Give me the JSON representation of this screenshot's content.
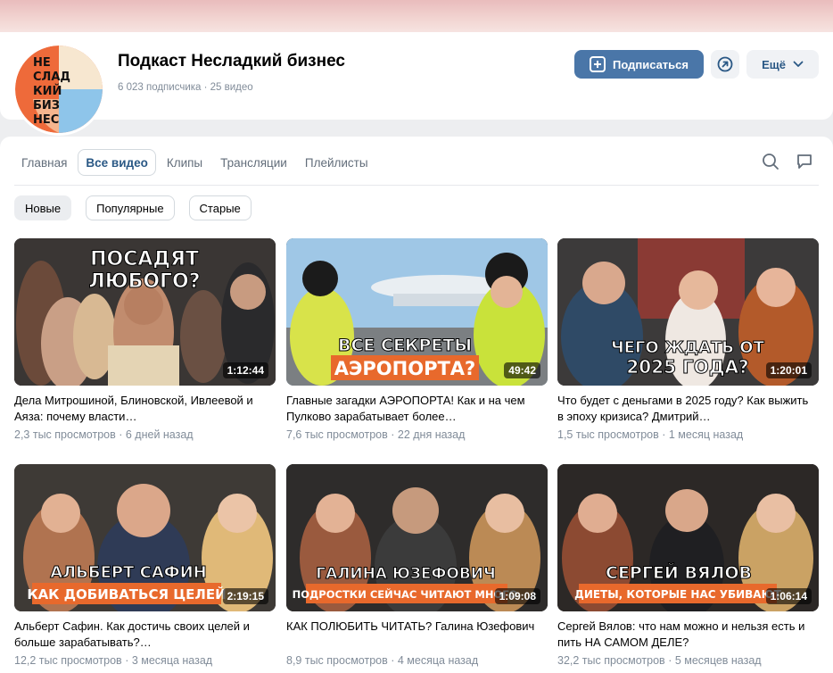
{
  "channel": {
    "title": "Подкаст Несладкий бизнес",
    "subscribers": "6 023 подписчика",
    "videos_count": "25 видео",
    "logo_lines": [
      "НЕ",
      "СЛАД",
      "КИЙ",
      "БИЗ",
      "НЕС"
    ]
  },
  "actions": {
    "subscribe_label": "Подписаться",
    "more_label": "Ещё"
  },
  "tabs": [
    {
      "label": "Главная"
    },
    {
      "label": "Все видео"
    },
    {
      "label": "Клипы"
    },
    {
      "label": "Трансляции"
    },
    {
      "label": "Плейлисты"
    }
  ],
  "filters": [
    {
      "label": "Новые"
    },
    {
      "label": "Популярные"
    },
    {
      "label": "Старые"
    }
  ],
  "videos": [
    {
      "title": "Дела Митрошиной, Блиновской, Ивлеевой и Аяза: почему власти…",
      "views": "2,3 тыс просмотров",
      "age": "6 дней назад",
      "duration": "1:12:44",
      "thumb_lines": [
        "ПОСАДЯТ",
        "ЛЮБОГО?"
      ]
    },
    {
      "title": "Главные загадки АЭРОПОРТА! Как и на чем Пулково зарабатывает более…",
      "views": "7,6 тыс просмотров",
      "age": "22 дня назад",
      "duration": "49:42",
      "thumb_lines": [
        "ВСЕ СЕКРЕТЫ",
        "АЭРОПОРТА?"
      ]
    },
    {
      "title": "Что будет с деньгами в 2025 году? Как выжить в эпоху кризиса? Дмитрий…",
      "views": "1,5 тыс просмотров",
      "age": "1 месяц назад",
      "duration": "1:20:01",
      "thumb_lines": [
        "ЧЕГО ЖДАТЬ ОТ",
        "2025 ГОДА?"
      ]
    },
    {
      "title": "Альберт Сафин. Как достичь своих целей и больше зарабатывать?…",
      "views": "12,2 тыс просмотров",
      "age": "3 месяца назад",
      "duration": "2:19:15",
      "thumb_lines": [
        "АЛЬБЕРТ САФИН",
        "КАК ДОБИВАТЬСЯ ЦЕЛЕЙ"
      ]
    },
    {
      "title": "КАК ПОЛЮБИТЬ ЧИТАТЬ? Галина Юзефович",
      "views": "8,9 тыс просмотров",
      "age": "4 месяца назад",
      "duration": "1:09:08",
      "thumb_lines": [
        "ГАЛИНА ЮЗЕФОВИЧ",
        "ПОДРОСТКИ СЕЙЧАС ЧИТАЮТ МНОГО"
      ]
    },
    {
      "title": "Сергей Вялов: что нам можно и нельзя есть и пить НА САМОМ ДЕЛЕ?",
      "views": "32,2 тыс просмотров",
      "age": "5 месяцев назад",
      "duration": "1:06:14",
      "thumb_lines": [
        "СЕРГЕЙ ВЯЛОВ",
        "ДИЕТЫ, КОТОРЫЕ НАС УБИВАЮТ"
      ]
    }
  ],
  "colors": {
    "accent": "#4a76a8",
    "link": "#2a5885",
    "secondary_text": "#818c99",
    "background": "#edeef0",
    "thumb_orange": "#e8692c"
  }
}
